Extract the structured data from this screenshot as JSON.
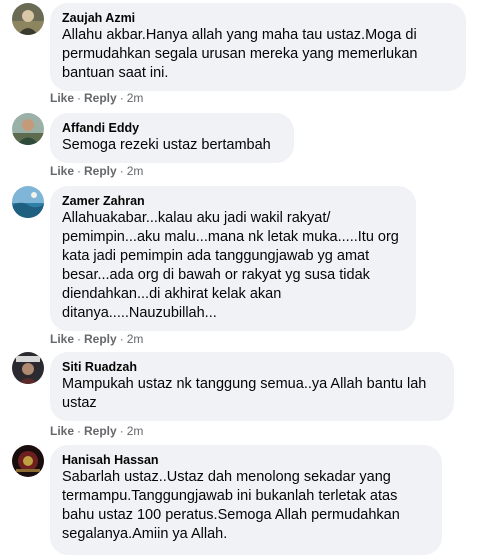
{
  "comments": [
    {
      "author": "Zaujah Azmi",
      "text": "Allahu akbar.Hanya allah yang maha tau ustaz.Moga di permudahkan segala urusan mereka yang memerlukan bantuan saat ini.",
      "like_label": "Like",
      "reply_label": "Reply",
      "time": "2m",
      "avatar_icon": "user-avatar-photo"
    },
    {
      "author": "Affandi Eddy",
      "text": "Semoga rezeki ustaz bertambah",
      "like_label": "Like",
      "reply_label": "Reply",
      "time": "2m",
      "avatar_icon": "user-avatar-photo"
    },
    {
      "author": "Zamer Zahran",
      "text": "Allahuakabar...kalau aku jadi wakil rakyat/ pemimpin...aku malu...mana nk letak muka.....Itu org kata jadi pemimpin ada tanggungjawab yg amat besar...ada org di bawah or rakyat yg susa tidak diendahkan...di akhirat kelak akan ditanya.....Nauzubillah...",
      "like_label": "Like",
      "reply_label": "Reply",
      "time": "2m",
      "avatar_icon": "user-avatar-photo"
    },
    {
      "author": "Siti Ruadzah",
      "text": "Mampukah ustaz nk tanggung semua..ya Allah bantu lah ustaz",
      "like_label": "Like",
      "reply_label": "Reply",
      "time": "2m",
      "avatar_icon": "user-avatar-photo"
    },
    {
      "author": "Hanisah Hassan",
      "text": "Sabarlah ustaz..Ustaz dah menolong sekadar yang termampu.Tanggungjawab ini bukanlah terletak atas bahu ustaz 100 peratus.Semoga Allah permudahkan segalanya.Amiin ya Allah.",
      "avatar_icon": "user-avatar-photo"
    }
  ],
  "separator": "·"
}
